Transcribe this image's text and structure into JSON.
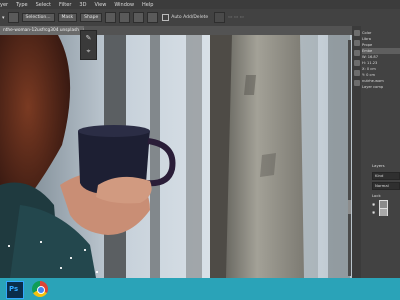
{
  "menu": [
    "yer",
    "Type",
    "Select",
    "Filter",
    "3D",
    "View",
    "Window",
    "Help"
  ],
  "options_bar": {
    "buttons": [
      "Selection...",
      "Mask",
      "Shape"
    ],
    "auto_add_delete": "Auto Add/Delete"
  },
  "document": {
    "tab_label": "nthe-woman-12usfrcg304 unsplash",
    "close_icon": "close-icon"
  },
  "properties_panel": {
    "rows": [
      "Color",
      "Libra",
      "Prope",
      "Embe",
      "W: 16.87",
      "H: 11.23",
      "X: 0 cm",
      "Y: 0 cm",
      "nutrhe-wom",
      "Layer comp"
    ]
  },
  "layers_panel": {
    "title": "Layers",
    "kind_filter": "Kind",
    "blend_mode": "Normal",
    "lock_label": "Lock"
  },
  "colors": {
    "menubar": "#3c3c3c",
    "panel": "#424242",
    "taskbar": "#2aa3b8",
    "photoshop_blue": "#0a2e4a",
    "photoshop_accent": "#31a8ff"
  },
  "taskbar": {
    "apps": [
      "photoshop-icon",
      "chrome-icon"
    ]
  }
}
